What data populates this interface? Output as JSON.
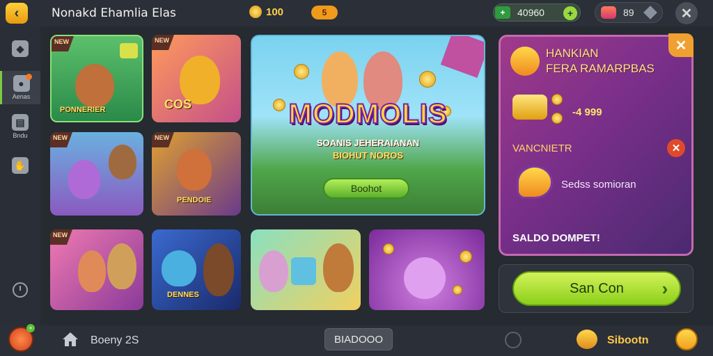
{
  "header": {
    "title": "Nonakd Ehamlia Elas",
    "coins": "100",
    "gem_badge": "5",
    "balance": "40960",
    "energy": "89",
    "icons": [
      "back-arrow-icon",
      "coin-icon",
      "cash-icon",
      "plus-icon",
      "energy-icon",
      "diamond-icon",
      "close-icon"
    ]
  },
  "sidebar": {
    "items": [
      {
        "label": "",
        "icon": "cat-head-icon"
      },
      {
        "label": "Aenas",
        "icon": "bird-icon"
      },
      {
        "label": "Bndu",
        "icon": "stats-icon"
      },
      {
        "label": "",
        "icon": "hand-icon"
      }
    ],
    "clock_icon": "clock-icon"
  },
  "tiles": [
    {
      "label": "PONNERIER",
      "tag": "NEW"
    },
    {
      "label": "COS",
      "tag": "NEW"
    },
    {
      "label": "",
      "tag": "NEW"
    },
    {
      "label": "PENDOIE",
      "tag": "NEW"
    },
    {
      "label": "",
      "tag": "NEW"
    },
    {
      "label": "DENNES",
      "tag": ""
    },
    {
      "label": "",
      "tag": ""
    },
    {
      "label": "",
      "tag": ""
    }
  ],
  "hero": {
    "title": "MODMOLIS",
    "subtitle1": "SOANIS JEHERAIANAN",
    "subtitle2": "BIOHUT NOROS",
    "button": "Boohot"
  },
  "offer": {
    "title_line1": "HANKIAN",
    "title_line2": "FERA RAMARPBAS",
    "amount": "-4 999",
    "section": "VANCNIETR",
    "description": "Sedss somioran",
    "footer": "SALDO DOMPET!",
    "close": "✕"
  },
  "cta": {
    "label": "San Con",
    "arrow": "›"
  },
  "bottom": {
    "home_label": "Boeny 2S",
    "middle_button": "BIADOOO",
    "right_label": "Sibootn",
    "fox_badge": "+"
  },
  "colors": {
    "accent_green": "#8ccf1a",
    "accent_gold": "#ffd24a",
    "panel_purple": "#7a2f8a",
    "bg": "#262a31"
  }
}
